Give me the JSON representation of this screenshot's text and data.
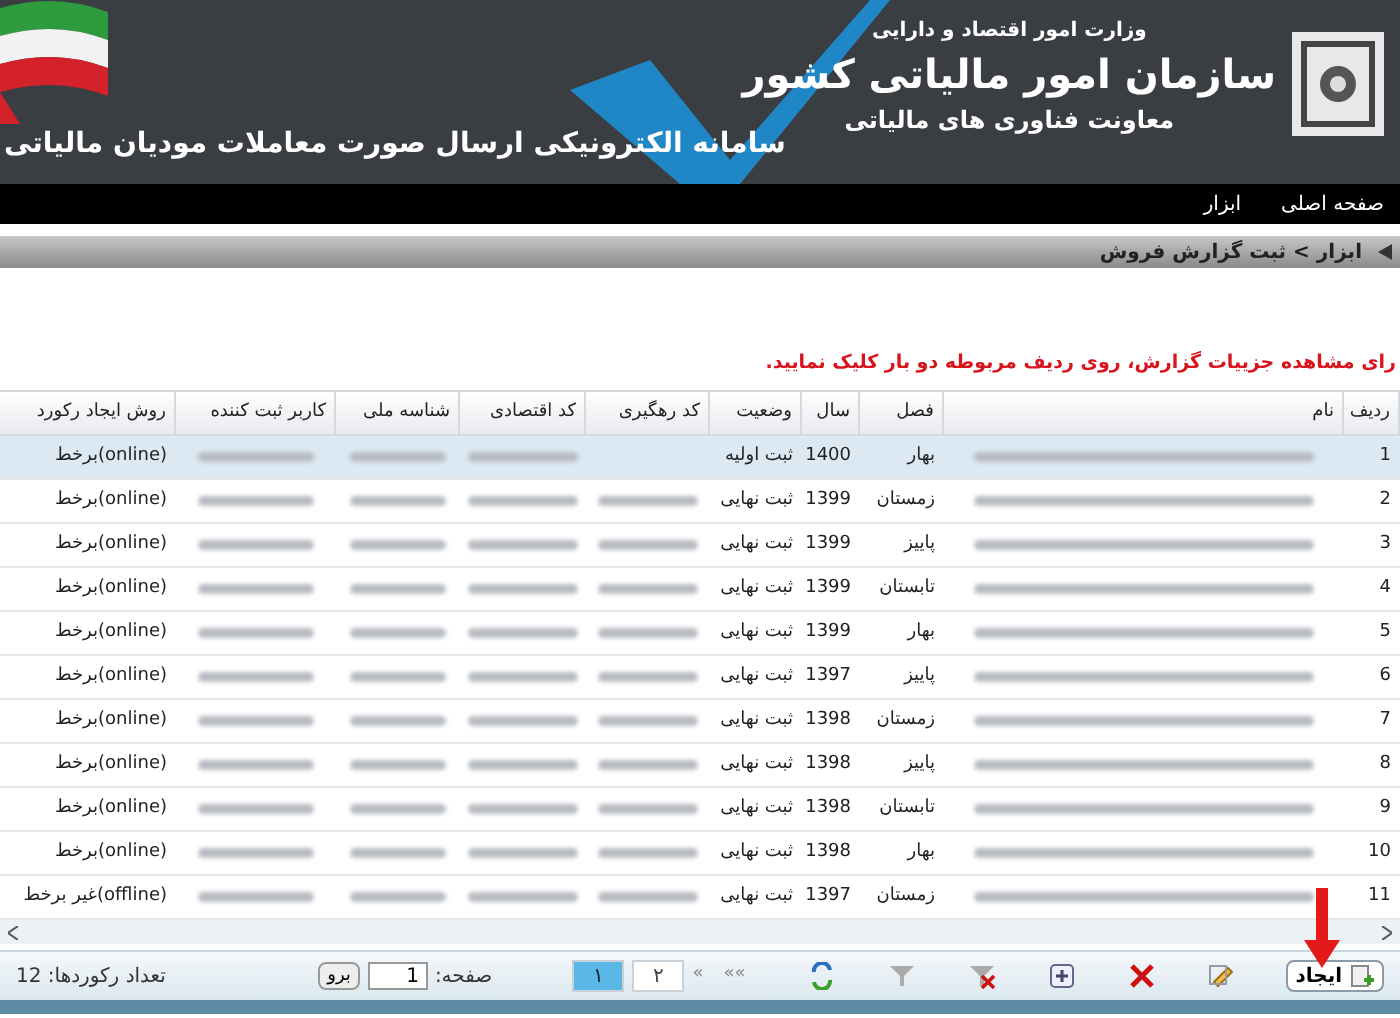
{
  "header": {
    "ministry": "وزارت امور اقتصاد و دارایی",
    "organization": "سازمان امور مالیاتی کشور",
    "deputy": "معاونت فناوری های مالیاتی",
    "system_title": "سامانه الکترونیکی ارسال صورت معاملات مودیان مالیاتی"
  },
  "nav": [
    {
      "label": "صفحه اصلی"
    },
    {
      "label": "ابزار"
    }
  ],
  "breadcrumb": "ابزار > ثبت گزارش فروش",
  "message": "رای مشاهده جزییات گزارش، روی ردیف مربوطه دو بار کلیک نمایید.",
  "table": {
    "columns": [
      "ردیف",
      "نام",
      "فصل",
      "سال",
      "وضعیت",
      "کد رهگیری",
      "کد اقتصادی",
      "شناسه ملی",
      "کاربر ثبت کننده",
      "روش ایجاد رکورد"
    ],
    "rows": [
      {
        "row": "1",
        "season": "بهار",
        "year": "1400",
        "status": "ثبت اولیه",
        "has_tracking_code": false,
        "method": "(online)برخط",
        "selected": true
      },
      {
        "row": "2",
        "season": "زمستان",
        "year": "1399",
        "status": "ثبت نهایی",
        "has_tracking_code": true,
        "method": "(online)برخط",
        "selected": false
      },
      {
        "row": "3",
        "season": "پاییز",
        "year": "1399",
        "status": "ثبت نهایی",
        "has_tracking_code": true,
        "method": "(online)برخط",
        "selected": false
      },
      {
        "row": "4",
        "season": "تابستان",
        "year": "1399",
        "status": "ثبت نهایی",
        "has_tracking_code": true,
        "method": "(online)برخط",
        "selected": false
      },
      {
        "row": "5",
        "season": "بهار",
        "year": "1399",
        "status": "ثبت نهایی",
        "has_tracking_code": true,
        "method": "(online)برخط",
        "selected": false
      },
      {
        "row": "6",
        "season": "پاییز",
        "year": "1397",
        "status": "ثبت نهایی",
        "has_tracking_code": true,
        "method": "(online)برخط",
        "selected": false
      },
      {
        "row": "7",
        "season": "زمستان",
        "year": "1398",
        "status": "ثبت نهایی",
        "has_tracking_code": true,
        "method": "(online)برخط",
        "selected": false
      },
      {
        "row": "8",
        "season": "پاییز",
        "year": "1398",
        "status": "ثبت نهایی",
        "has_tracking_code": true,
        "method": "(online)برخط",
        "selected": false
      },
      {
        "row": "9",
        "season": "تابستان",
        "year": "1398",
        "status": "ثبت نهایی",
        "has_tracking_code": true,
        "method": "(online)برخط",
        "selected": false
      },
      {
        "row": "10",
        "season": "بهار",
        "year": "1398",
        "status": "ثبت نهایی",
        "has_tracking_code": true,
        "method": "(online)برخط",
        "selected": false
      },
      {
        "row": "11",
        "season": "زمستان",
        "year": "1397",
        "status": "ثبت نهایی",
        "has_tracking_code": true,
        "method": "(offline)غیر برخط",
        "selected": false
      }
    ]
  },
  "toolbar": {
    "create_button": "ایجاد",
    "first": "»»",
    "prev": "»",
    "pages": [
      {
        "label": "۲",
        "selected": false
      },
      {
        "label": "۱",
        "selected": true
      }
    ],
    "page_label": "صفحه:",
    "page_value": "1",
    "go_button": "برو",
    "record_count": "تعداد رکوردها: 12"
  }
}
